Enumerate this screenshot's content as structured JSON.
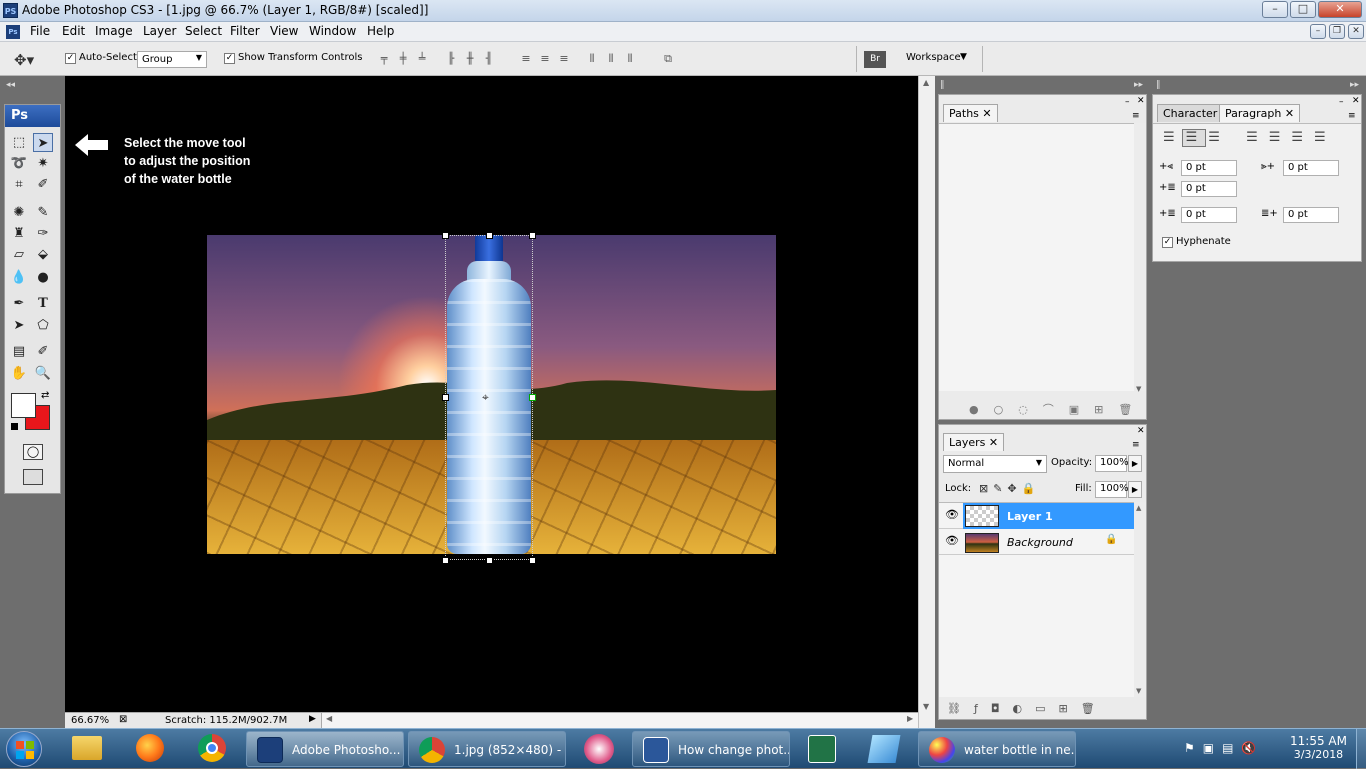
{
  "window": {
    "title": "Adobe Photoshop CS3 - [1.jpg @ 66.7% (Layer 1, RGB/8#) [scaled]]",
    "logo": "PS"
  },
  "menu": [
    "File",
    "Edit",
    "Image",
    "Layer",
    "Select",
    "Filter",
    "View",
    "Window",
    "Help"
  ],
  "options": {
    "auto_select_label": "Auto-Select:",
    "auto_select_value": "Group",
    "show_transform_label": "Show Transform Controls",
    "workspace_label": "Workspace"
  },
  "toolbox": {
    "logo": "Ps"
  },
  "annotation": {
    "line1": "Select the move tool",
    "line2": "to adjust the position",
    "line3": "of the water bottle"
  },
  "status": {
    "zoom": "66.67%",
    "scratch": "Scratch: 115.2M/902.7M"
  },
  "paths_panel": {
    "tab": "Paths"
  },
  "para_panel": {
    "tabs": [
      "Character",
      "Paragraph"
    ],
    "values": [
      "0 pt",
      "0 pt",
      "0 pt",
      "0 pt",
      "0 pt"
    ],
    "hyphenate": "Hyphenate"
  },
  "layers_panel": {
    "tab": "Layers",
    "blend_mode": "Normal",
    "opacity_label": "Opacity:",
    "opacity": "100%",
    "lock_label": "Lock:",
    "fill_label": "Fill:",
    "fill": "100%",
    "layers": [
      "Layer 1",
      "Background"
    ]
  },
  "taskbar": {
    "items": [
      "Adobe Photosho...",
      "1.jpg (852×480) - ...",
      "How change phot...",
      "water bottle in  ne..."
    ],
    "time": "11:55 AM",
    "date": "3/3/2018"
  },
  "colors": {
    "accent": "#3399ff",
    "foreground": "#ffffff",
    "background": "#e8161b"
  }
}
